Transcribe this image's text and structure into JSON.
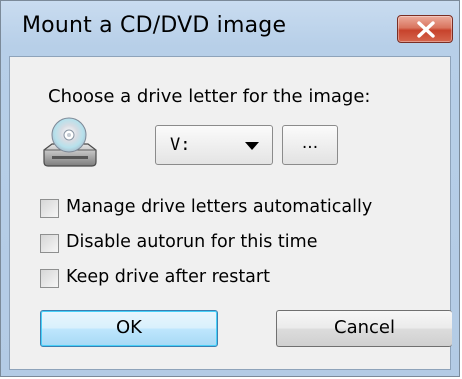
{
  "window": {
    "title": "Mount a CD/DVD image",
    "close_icon": "close-x-icon"
  },
  "content": {
    "prompt": "Choose a drive letter for the image:",
    "drive_icon": "cd-drive-icon",
    "drive_select": {
      "value": "V:"
    },
    "browse_label": "...",
    "options": [
      {
        "label": "Manage drive letters automatically",
        "checked": false
      },
      {
        "label": "Disable autorun for this time",
        "checked": false
      },
      {
        "label": "Keep drive after restart",
        "checked": false
      }
    ]
  },
  "buttons": {
    "ok": "OK",
    "cancel": "Cancel"
  },
  "colors": {
    "title_bar": "#b9d1ea",
    "close_button": "#c7432c",
    "client_bg": "#f0f0f0",
    "default_button_border": "#3c7fb1"
  }
}
